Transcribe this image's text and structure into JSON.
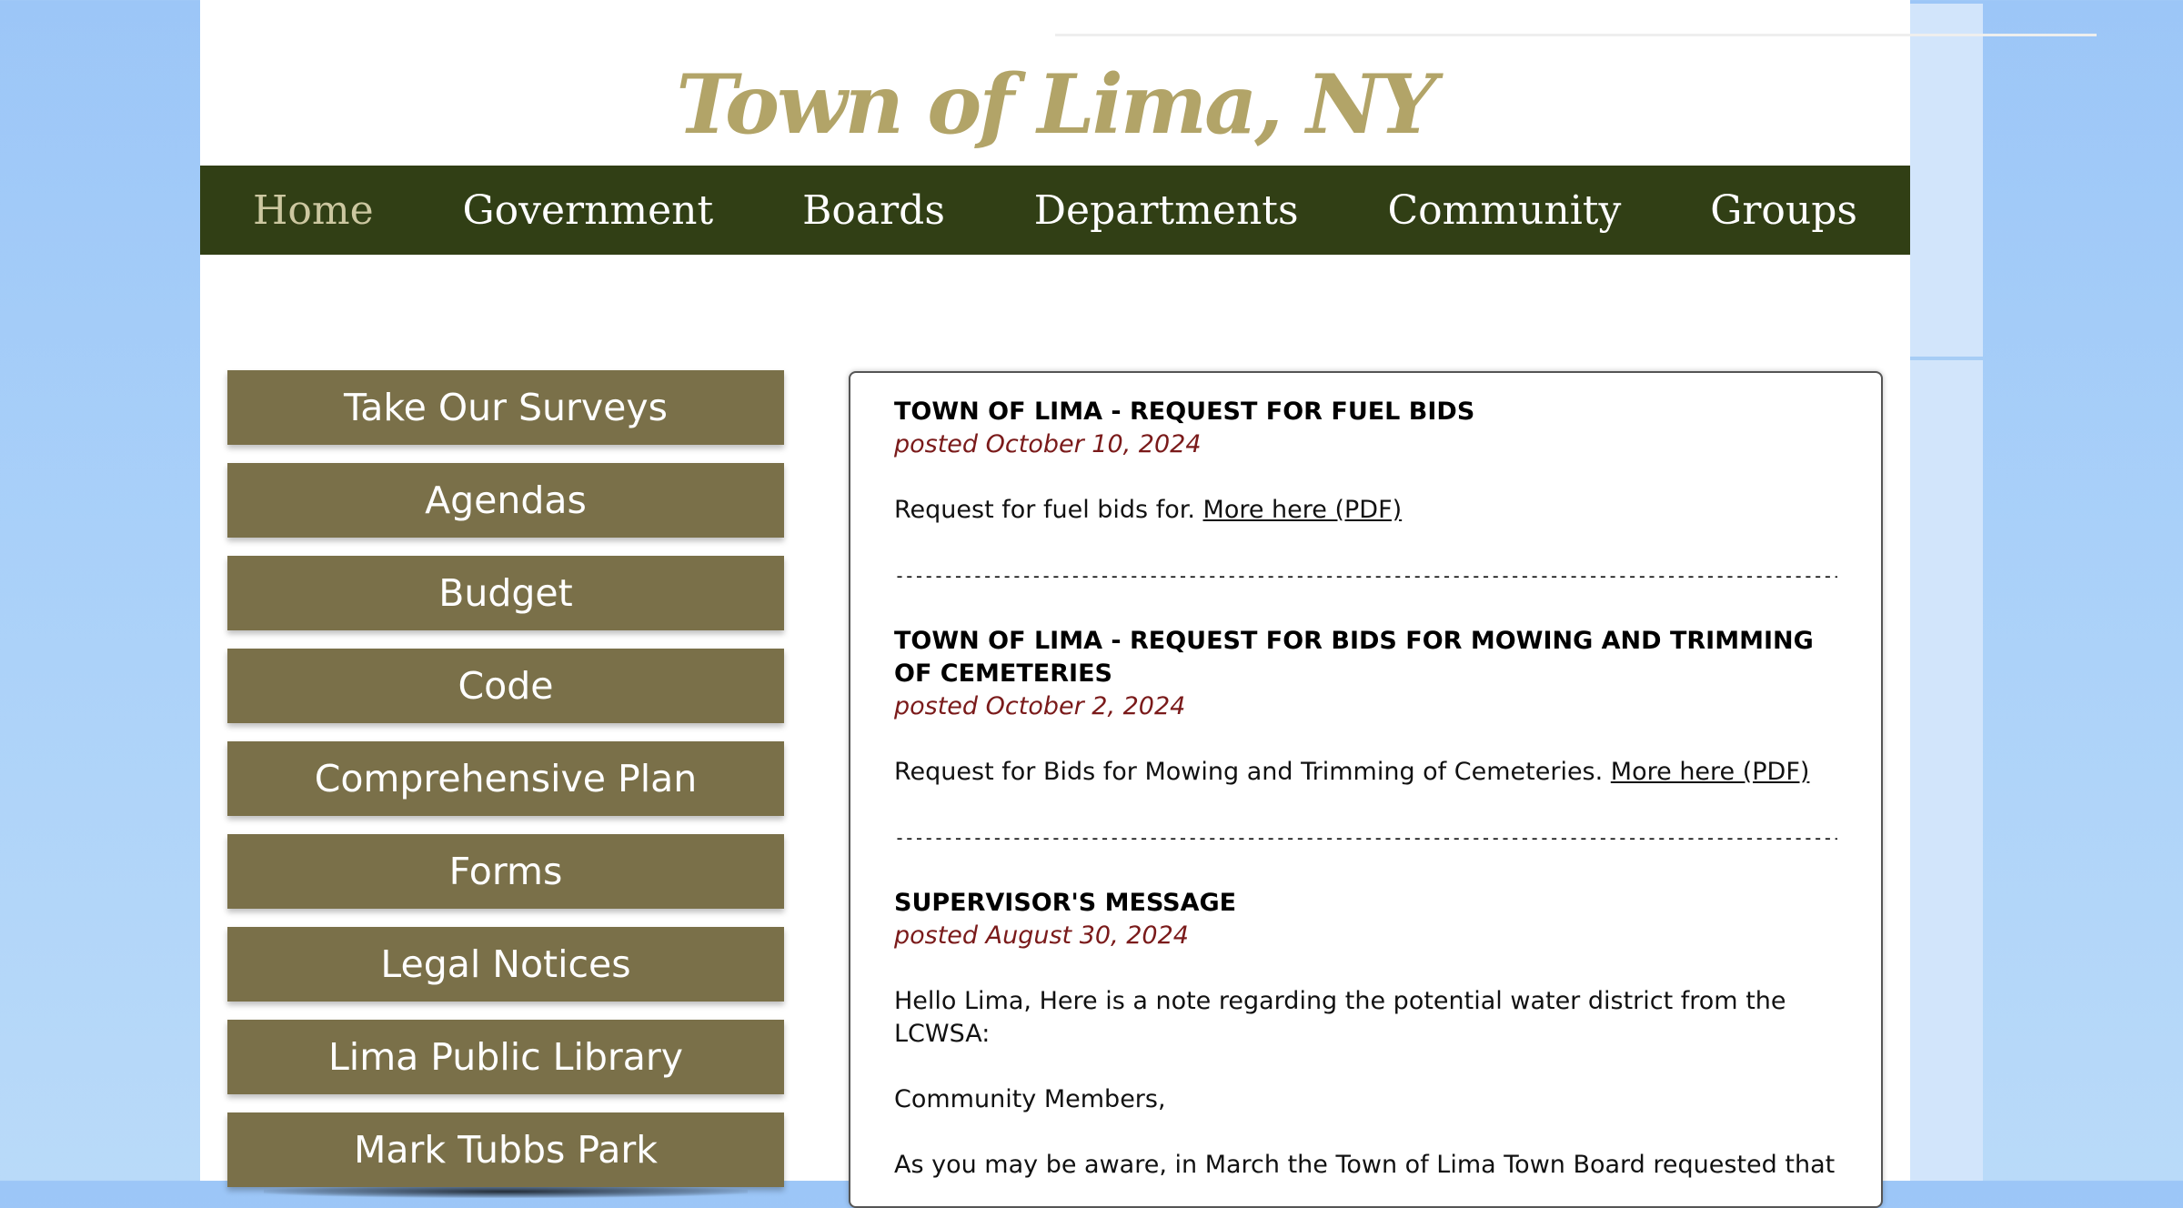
{
  "site": {
    "title": "Town of Lima, NY"
  },
  "nav": {
    "items": [
      {
        "label": "Home",
        "active": true
      },
      {
        "label": "Government"
      },
      {
        "label": "Boards"
      },
      {
        "label": "Departments"
      },
      {
        "label": "Community"
      },
      {
        "label": "Groups"
      }
    ]
  },
  "sidebar": {
    "items": [
      {
        "label": "Take Our Surveys"
      },
      {
        "label": "Agendas"
      },
      {
        "label": "Budget"
      },
      {
        "label": "Code"
      },
      {
        "label": "Comprehensive Plan"
      },
      {
        "label": "Forms"
      },
      {
        "label": "Legal Notices"
      },
      {
        "label": "Lima Public Library"
      },
      {
        "label": "Mark Tubbs Park"
      }
    ]
  },
  "news": {
    "divider": "--------------------------------------------------------------------------------------------------",
    "posts": [
      {
        "title": "TOWN OF LIMA - REQUEST FOR FUEL BIDS",
        "date": "posted October 10, 2024",
        "body": "Request for fuel bids for. ",
        "link": "More here (PDF)"
      },
      {
        "title": "TOWN OF LIMA - REQUEST FOR BIDS FOR MOWING AND TRIMMING OF CEMETERIES",
        "date": "posted October 2, 2024",
        "body": "Request for Bids for Mowing and Trimming of Cemeteries. ",
        "link": "More here (PDF)"
      },
      {
        "title": "SUPERVISOR'S MESSAGE",
        "date": "posted August 30, 2024",
        "paragraphs": [
          "Hello Lima, Here is a note regarding the potential water district from the LCWSA:",
          "Community Members,",
          "As you may be aware, in March the Town of Lima Town Board requested that"
        ]
      }
    ]
  },
  "colors": {
    "nav_bg": "#313f15",
    "title_gold": "#b2a468",
    "sidebar_button": "#7a7049",
    "date_red": "#7a1a1a",
    "sky_blue": "#a9d0f9"
  }
}
